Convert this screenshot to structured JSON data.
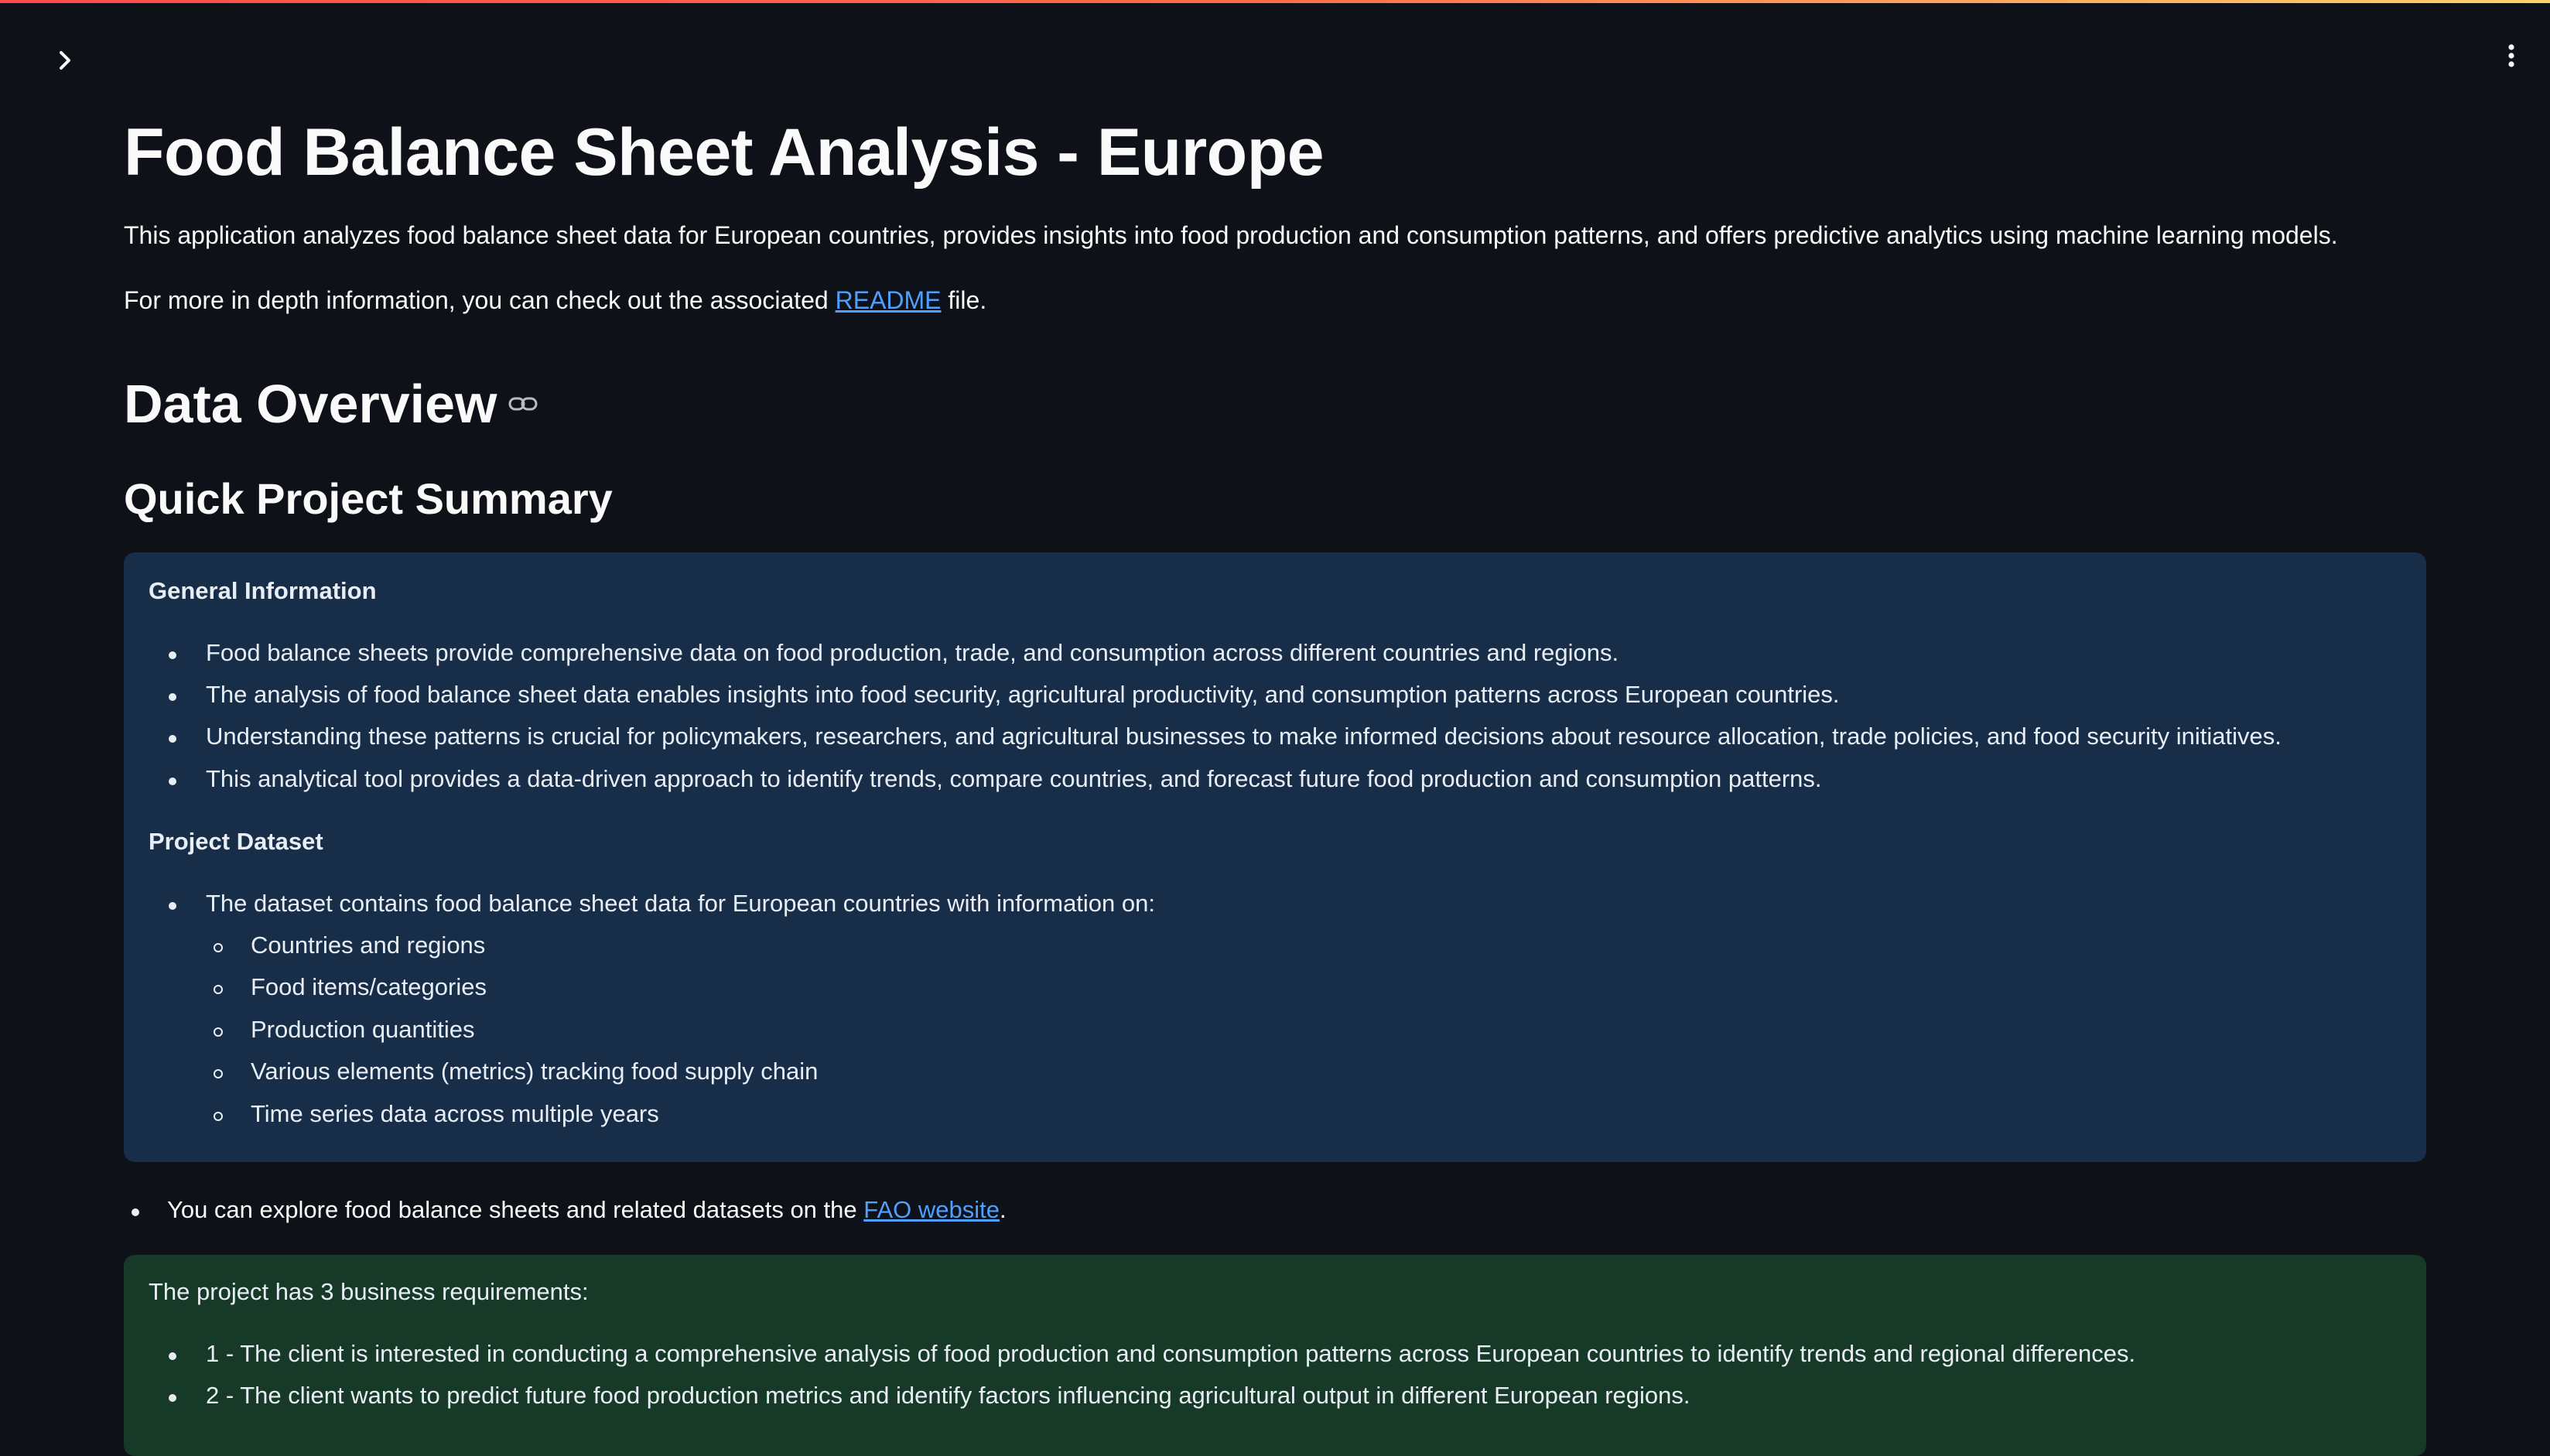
{
  "header": {
    "sidebar_toggle_icon": "chevron-right-icon",
    "menu_icon": "vertical-ellipsis-icon"
  },
  "page": {
    "title": "Food Balance Sheet Analysis - Europe",
    "intro": "This application analyzes food balance sheet data for European countries, provides insights into food production and consumption patterns, and offers predictive analytics using machine learning models.",
    "readme_prefix": "For more in depth information, you can check out the associated ",
    "readme_link": "README",
    "readme_suffix": " file."
  },
  "section": {
    "heading": "Data Overview",
    "anchor_icon": "link-icon",
    "subheading": "Quick Project Summary"
  },
  "info_box": {
    "general_heading": "General Information",
    "general_items": [
      "Food balance sheets provide comprehensive data on food production, trade, and consumption across different countries and regions.",
      "The analysis of food balance sheet data enables insights into food security, agricultural productivity, and consumption patterns across European countries.",
      "Understanding these patterns is crucial for policymakers, researchers, and agricultural businesses to make informed decisions about resource allocation, trade policies, and food security initiatives.",
      "This analytical tool provides a data-driven approach to identify trends, compare countries, and forecast future food production and consumption patterns."
    ],
    "dataset_heading": "Project Dataset",
    "dataset_item": "The dataset contains food balance sheet data for European countries with information on:",
    "dataset_subitems": [
      "Countries and regions",
      "Food items/categories",
      "Production quantities",
      "Various elements (metrics) tracking food supply chain",
      "Time series data across multiple years"
    ]
  },
  "note": {
    "prefix": "You can explore food balance sheets and related datasets on the ",
    "link": "FAO website",
    "suffix": "."
  },
  "success_box": {
    "intro": "The project has 3 business requirements:",
    "requirements": [
      "1 - The client is interested in conducting a comprehensive analysis of food production and consumption patterns across European countries to identify trends and regional differences.",
      "2 - The client wants to predict future food production metrics and identify factors influencing agricultural output in different European regions."
    ]
  },
  "colors": {
    "background": "#0e1117",
    "info_box": "#172d48",
    "success_box": "#173927",
    "link": "#4ea0ff",
    "top_bar_start": "#ff4b4b",
    "top_bar_end": "#ffd36b"
  }
}
